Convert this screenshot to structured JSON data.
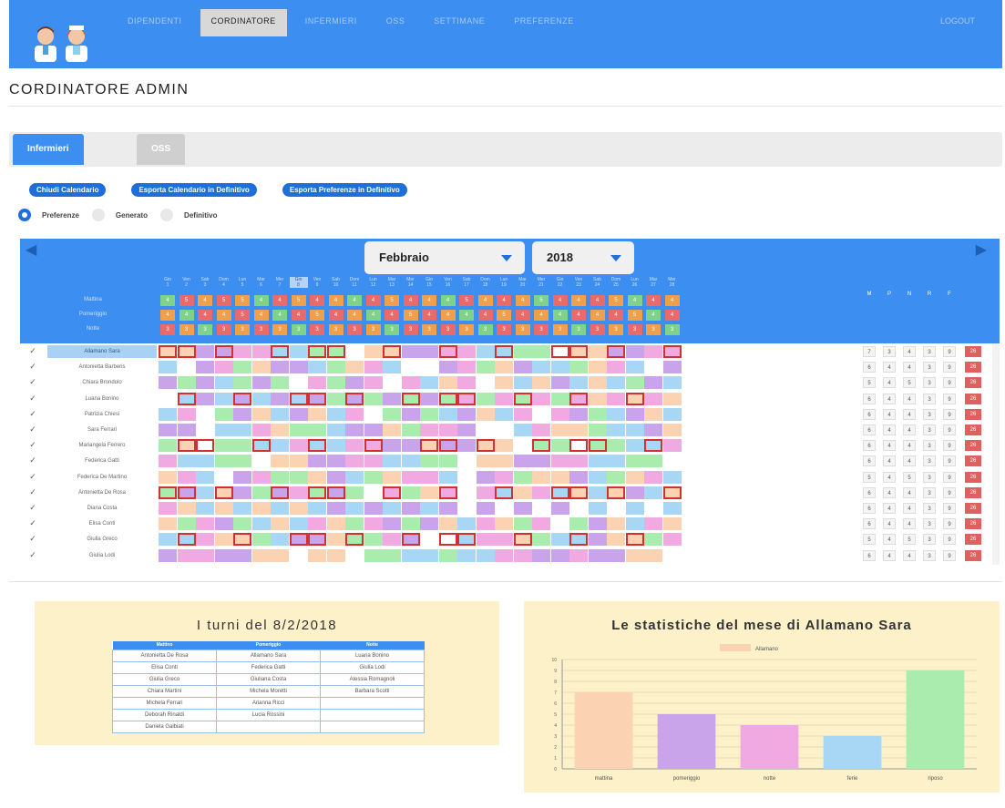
{
  "nav": {
    "items": [
      "Dipendenti",
      "Cordinatore",
      "Infermieri",
      "OSS",
      "Settimane",
      "Preferenze"
    ],
    "active_index": 1,
    "right": "Logout"
  },
  "page_title": "CORDINATORE ADMIN",
  "tabs": [
    "Infermieri",
    "OSS"
  ],
  "actions": [
    "Chiudi Calendario",
    "Esporta Calendario in Definitivo",
    "Esporta Preferenze in Definitivo"
  ],
  "radios": {
    "options": [
      "Preferenze",
      "Generato",
      "Definitivo"
    ],
    "selected": 0
  },
  "calendar": {
    "month": "Febbraio",
    "year": "2018",
    "today_index": 7,
    "day_headers": [
      "Gio 1",
      "Ven 2",
      "Sab 3",
      "Dom 4",
      "Lun 5",
      "Mar 6",
      "Mer 7",
      "Gio 8",
      "Ven 9",
      "Sab 10",
      "Dom 11",
      "Lun 12",
      "Mar 13",
      "Mer 14",
      "Gio 15",
      "Ven 16",
      "Sab 17",
      "Dom 18",
      "Lun 19",
      "Mar 20",
      "Mer 21",
      "Gio 22",
      "Ven 23",
      "Sab 24",
      "Dom 25",
      "Lun 26",
      "Mar 27",
      "Mer 28"
    ],
    "summary_labels": [
      "Mattina",
      "Pomeriggio",
      "Notte"
    ],
    "summary_values": [
      [
        "4",
        "5",
        "4",
        "5",
        "5",
        "4",
        "4",
        "5",
        "4",
        "4",
        "4",
        "4",
        "5",
        "4",
        "4",
        "4",
        "5",
        "4",
        "4",
        "4",
        "5",
        "4",
        "4",
        "4",
        "5",
        "4",
        "4",
        "4"
      ],
      [
        "4",
        "4",
        "4",
        "4",
        "5",
        "4",
        "4",
        "4",
        "5",
        "4",
        "4",
        "4",
        "4",
        "5",
        "4",
        "4",
        "4",
        "4",
        "5",
        "4",
        "4",
        "4",
        "4",
        "4",
        "4",
        "5",
        "4",
        "4"
      ],
      [
        "3",
        "3",
        "3",
        "3",
        "3",
        "3",
        "3",
        "3",
        "3",
        "3",
        "3",
        "3",
        "3",
        "3",
        "3",
        "3",
        "3",
        "3",
        "3",
        "3",
        "3",
        "3",
        "3",
        "3",
        "3",
        "3",
        "3",
        "3"
      ]
    ],
    "stat_headers": [
      "M",
      "P",
      "N",
      "R",
      "F"
    ],
    "employees": [
      {
        "name": "Allamano Sara",
        "selected": true,
        "stats": [
          "7",
          "3",
          "4",
          "3",
          "9"
        ],
        "total": "26"
      },
      {
        "name": "Antonietta Barberis",
        "selected": false,
        "stats": [
          "6",
          "4",
          "4",
          "3",
          "9"
        ],
        "total": "26"
      },
      {
        "name": "Chiara Brondolo",
        "selected": false,
        "stats": [
          "5",
          "4",
          "5",
          "3",
          "9"
        ],
        "total": "26"
      },
      {
        "name": "Luana Bonino",
        "selected": false,
        "stats": [
          "6",
          "4",
          "4",
          "3",
          "9"
        ],
        "total": "26"
      },
      {
        "name": "Patrizia Chiesi",
        "selected": false,
        "stats": [
          "6",
          "4",
          "4",
          "3",
          "9"
        ],
        "total": "26"
      },
      {
        "name": "Sara Ferrari",
        "selected": false,
        "stats": [
          "6",
          "4",
          "4",
          "3",
          "9"
        ],
        "total": "26"
      },
      {
        "name": "Mariangela Ferrero",
        "selected": false,
        "stats": [
          "6",
          "4",
          "4",
          "3",
          "9"
        ],
        "total": "26"
      },
      {
        "name": "Federica Gatti",
        "selected": false,
        "stats": [
          "6",
          "4",
          "4",
          "3",
          "9"
        ],
        "total": "26"
      },
      {
        "name": "Federica De Martino",
        "selected": false,
        "stats": [
          "5",
          "4",
          "5",
          "3",
          "9"
        ],
        "total": "26"
      },
      {
        "name": "Antonietta De Rosa",
        "selected": false,
        "stats": [
          "6",
          "4",
          "4",
          "3",
          "9"
        ],
        "total": "26"
      },
      {
        "name": "Diana Costa",
        "selected": false,
        "stats": [
          "6",
          "4",
          "4",
          "3",
          "9"
        ],
        "total": "26"
      },
      {
        "name": "Elisa Conti",
        "selected": false,
        "stats": [
          "6",
          "4",
          "4",
          "3",
          "9"
        ],
        "total": "26"
      },
      {
        "name": "Giulia Greco",
        "selected": false,
        "stats": [
          "5",
          "4",
          "5",
          "3",
          "9"
        ],
        "total": "26"
      },
      {
        "name": "Giulia Lodi",
        "selected": false,
        "stats": [
          "6",
          "4",
          "4",
          "3",
          "9"
        ],
        "total": "26"
      }
    ]
  },
  "shift_panel": {
    "title": "I turni del 8/2/2018",
    "headers": [
      "Mattino",
      "Pomeriggio",
      "Notte"
    ],
    "rows": [
      [
        "Antonietta De Rosa",
        "Allamano Sara",
        "Luana Bonino"
      ],
      [
        "Elisa Conti",
        "Federica Gatti",
        "Giulia Lodi"
      ],
      [
        "Giulia Greco",
        "Giuliana Costa",
        "Alessia Romagnoli"
      ],
      [
        "Chiara Martini",
        "Michela Moretti",
        "Barbara Scotti"
      ],
      [
        "Michela Ferrari",
        "Arianna Ricci",
        ""
      ],
      [
        "Deborah Rinaldi",
        "Lucia Rossini",
        ""
      ],
      [
        "Daniela Galbiati",
        "",
        ""
      ]
    ]
  },
  "colors": {
    "accent": "#3c8ef0",
    "dark_accent": "#1e6fd9",
    "panel_bg": "#fcf1c9",
    "cell_peach": "#fbd3b3",
    "cell_purple": "#c9a4ea",
    "cell_pink": "#f1a9e2",
    "cell_blue": "#a8d6f5",
    "cell_green": "#a9ecad",
    "cell_empty": "#ffffff",
    "red_summary": "#e86a6a",
    "orange_summary": "#f0a04a",
    "green_summary": "#7fd28a"
  },
  "chart_data": {
    "type": "bar",
    "title": "Le statistiche del mese di Allamano Sara",
    "legend": [
      "Allamano"
    ],
    "categories": [
      "mattina",
      "pomeriggio",
      "notte",
      "ferie",
      "riposo"
    ],
    "values": [
      7,
      5,
      4,
      3,
      9
    ],
    "colors": [
      "#fbd3b3",
      "#c9a4ea",
      "#f1a9e2",
      "#a8d6f5",
      "#a9ecad"
    ],
    "ylim": [
      0,
      10
    ],
    "grid": true
  }
}
